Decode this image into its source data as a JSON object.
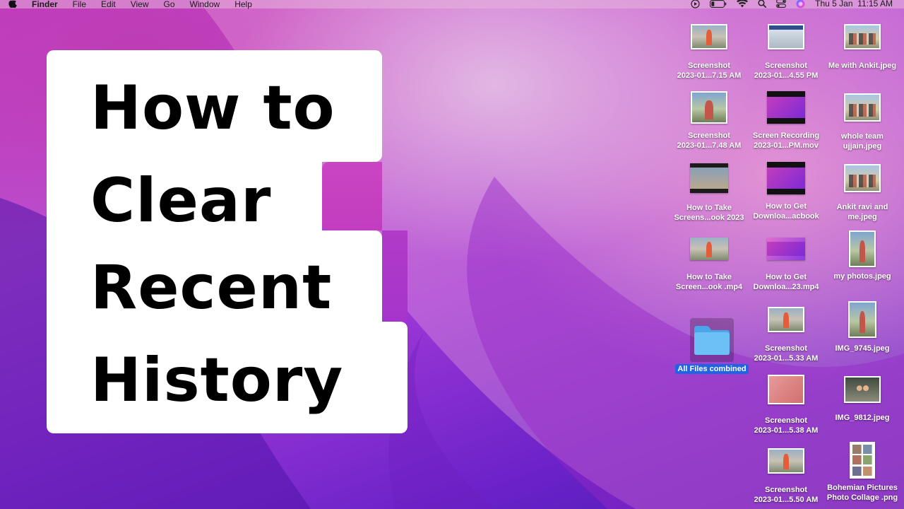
{
  "menubar": {
    "app_name": "Finder",
    "menus": [
      "File",
      "Edit",
      "View",
      "Go",
      "Window",
      "Help"
    ],
    "clock": "Thu 5 Jan  11:15 AM",
    "icons": [
      "apple-icon",
      "play-icon",
      "battery-icon",
      "wifi-icon",
      "search-icon",
      "control-center-icon",
      "siri-icon"
    ]
  },
  "title": {
    "lines": [
      "How to",
      "Clear",
      "Recent",
      "History"
    ]
  },
  "desktop": {
    "icons": [
      {
        "line1": "Screenshot",
        "line2": "2023-01...7.15 AM"
      },
      {
        "line1": "Screenshot",
        "line2": "2023-01...4.55 PM"
      },
      {
        "line1": "Me with Ankit.jpeg",
        "line2": ""
      },
      {
        "line1": "Screenshot",
        "line2": "2023-01...7.48 AM"
      },
      {
        "line1": "Screen Recording",
        "line2": "2023-01...PM.mov"
      },
      {
        "line1": "whole team",
        "line2": "ujjain.jpeg"
      },
      {
        "line1": "How to Take",
        "line2": "Screens...ook 2023"
      },
      {
        "line1": "How to Get",
        "line2": "Downloa...acbook"
      },
      {
        "line1": "Ankit ravi and",
        "line2": "me.jpeg"
      },
      {
        "line1": "How to Take",
        "line2": "Screen...ook .mp4"
      },
      {
        "line1": "How to Get",
        "line2": "Downloa...23.mp4"
      },
      {
        "line1": "my photos.jpeg",
        "line2": ""
      },
      {
        "line1": "All Files combined",
        "line2": ""
      },
      {
        "line1": "Screenshot",
        "line2": "2023-01...5.33 AM"
      },
      {
        "line1": "IMG_9745.jpeg",
        "line2": ""
      },
      {
        "line1": "Screenshot",
        "line2": "2023-01...5.38 AM"
      },
      {
        "line1": "IMG_9812.jpeg",
        "line2": ""
      },
      {
        "line1": "Screenshot",
        "line2": "2023-01...5.50 AM"
      },
      {
        "line1": "Bohemian Pictures",
        "line2": "Photo Collage .png"
      }
    ]
  }
}
